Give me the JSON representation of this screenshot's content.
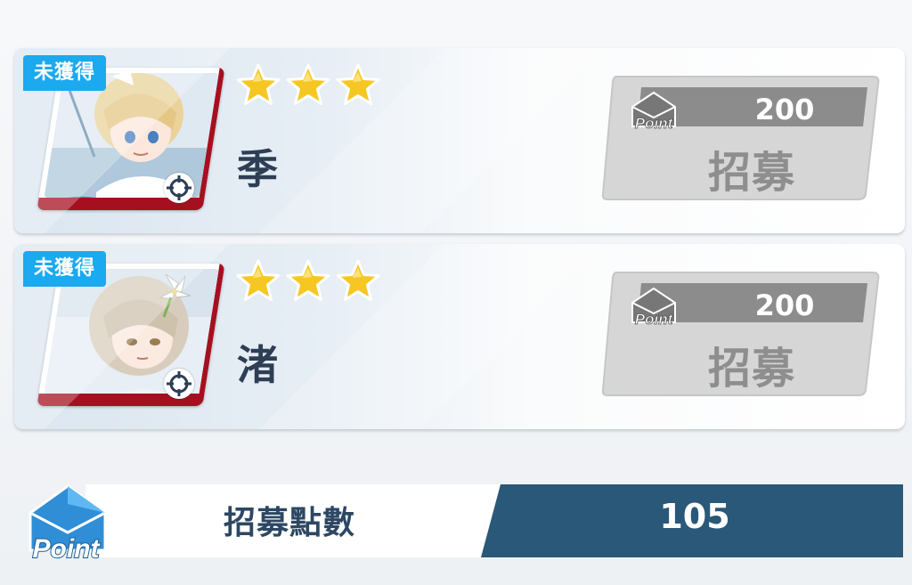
{
  "recruit_list": [
    {
      "status_badge": "未獲得",
      "stars": 3,
      "name": "季",
      "cost": "200",
      "cost_icon": "point-icon",
      "button_label": "招募",
      "hair_color": "#e9d39a",
      "outfit_color": "#ffffff"
    },
    {
      "status_badge": "未獲得",
      "stars": 3,
      "name": "渚",
      "cost": "200",
      "cost_icon": "point-icon",
      "button_label": "招募",
      "hair_color": "#d8cdbc",
      "outfit_color": "#f2f2f2"
    }
  ],
  "footer": {
    "icon_text": "Point",
    "label": "招募點數",
    "value": "105"
  },
  "colors": {
    "badge_blue": "#1ba9ef",
    "star_gold": "#f6c722",
    "frame_red": "#a51020",
    "button_gray": "#d4d4d4",
    "footer_blue": "#2a5878"
  }
}
